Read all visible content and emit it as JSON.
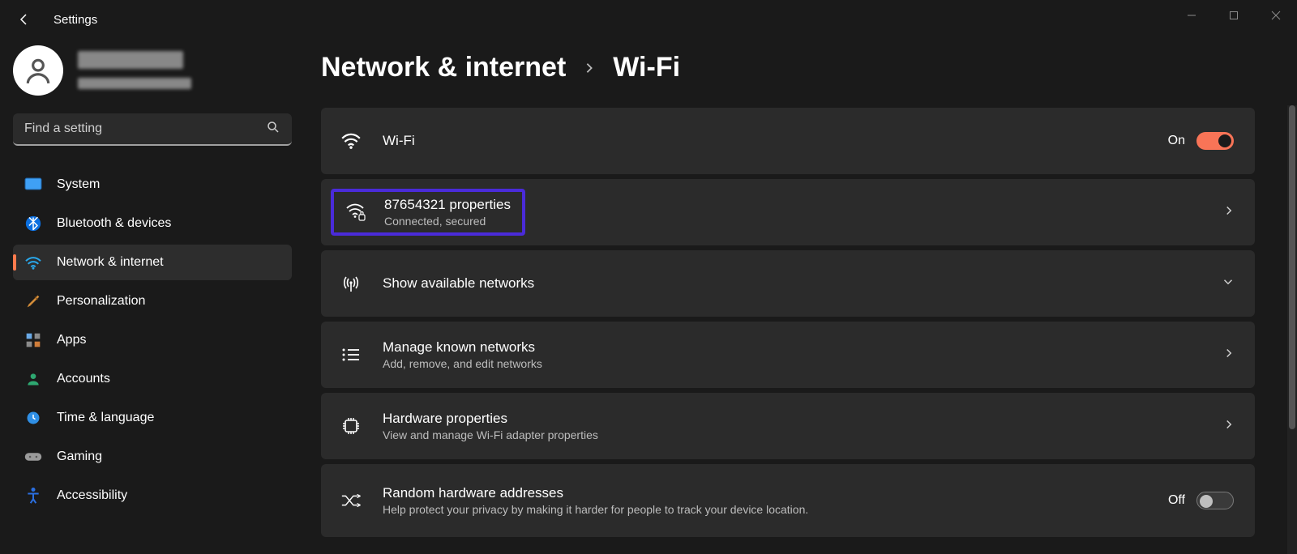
{
  "window": {
    "title": "Settings"
  },
  "search": {
    "placeholder": "Find a setting"
  },
  "nav": {
    "items": [
      {
        "label": "System"
      },
      {
        "label": "Bluetooth & devices"
      },
      {
        "label": "Network & internet"
      },
      {
        "label": "Personalization"
      },
      {
        "label": "Apps"
      },
      {
        "label": "Accounts"
      },
      {
        "label": "Time & language"
      },
      {
        "label": "Gaming"
      },
      {
        "label": "Accessibility"
      }
    ],
    "active_index": 2
  },
  "breadcrumb": {
    "parent": "Network & internet",
    "current": "Wi-Fi"
  },
  "wifi_toggle": {
    "title": "Wi-Fi",
    "state_label": "On"
  },
  "connected": {
    "title": "87654321 properties",
    "sub": "Connected, secured"
  },
  "available": {
    "title": "Show available networks"
  },
  "known": {
    "title": "Manage known networks",
    "sub": "Add, remove, and edit networks"
  },
  "hardware": {
    "title": "Hardware properties",
    "sub": "View and manage Wi-Fi adapter properties"
  },
  "random": {
    "title": "Random hardware addresses",
    "sub": "Help protect your privacy by making it harder for people to track your device location.",
    "state_label": "Off"
  }
}
